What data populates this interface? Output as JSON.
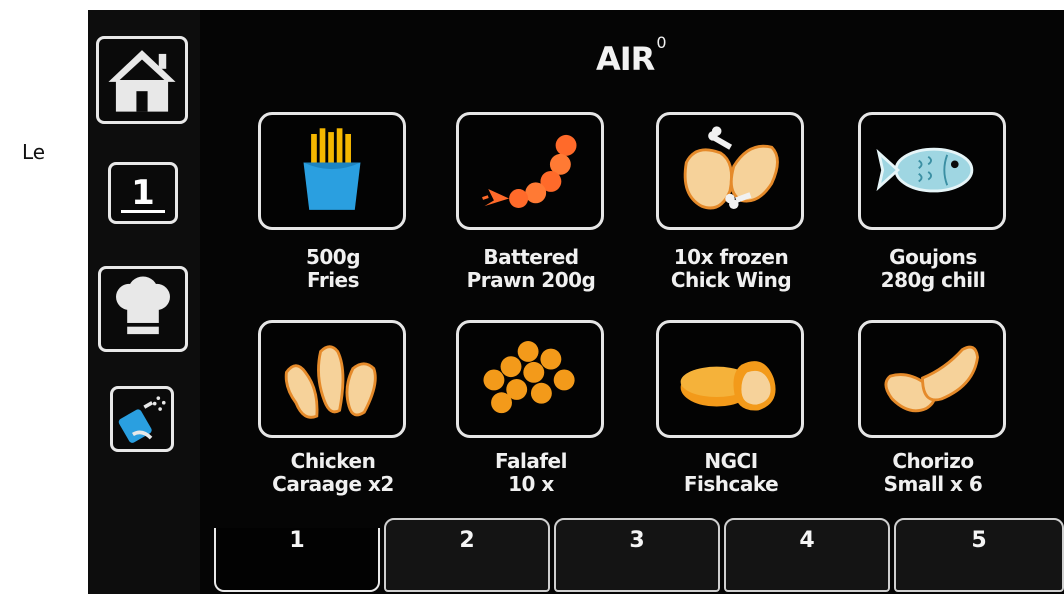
{
  "side_text": "Le",
  "header": {
    "logo": "AIR",
    "logo_superscript": "0"
  },
  "sidebar": {
    "items": [
      {
        "name": "home",
        "icon": "house-icon"
      },
      {
        "name": "page",
        "icon": "page-number-icon",
        "label": "1"
      },
      {
        "name": "chef",
        "icon": "chef-hat-icon"
      },
      {
        "name": "clean",
        "icon": "cleaning-spray-icon"
      }
    ]
  },
  "presets": [
    {
      "line1": "500g",
      "line2": "Fries",
      "icon": "fries-icon"
    },
    {
      "line1": "Battered",
      "line2": "Prawn 200g",
      "icon": "prawn-icon"
    },
    {
      "line1": "10x frozen",
      "line2": "Chick Wing",
      "icon": "chicken-wing-icon"
    },
    {
      "line1": "Goujons",
      "line2": "280g chill",
      "icon": "fish-icon"
    },
    {
      "line1": "Chicken",
      "line2": "Caraage x2",
      "icon": "chicken-karaage-icon"
    },
    {
      "line1": "Falafel",
      "line2": "10 x",
      "icon": "falafel-icon"
    },
    {
      "line1": "NGCI",
      "line2": "Fishcake",
      "icon": "fishcake-icon"
    },
    {
      "line1": "Chorizo",
      "line2": "Small x 6",
      "icon": "chorizo-icon"
    }
  ],
  "tabs": [
    {
      "label": "1",
      "active": true
    },
    {
      "label": "2",
      "active": false
    },
    {
      "label": "3",
      "active": false
    },
    {
      "label": "4",
      "active": false
    },
    {
      "label": "5",
      "active": false
    }
  ],
  "colors": {
    "background": "#050505",
    "border": "#e6e6e6",
    "fries": "#f5b700",
    "fries_box": "#2a9fe0",
    "prawn": "#ff6a2a",
    "food_light": "#f6d29a",
    "food_outline": "#e58a2a",
    "fish": "#9fd6e2",
    "falafel": "#f39a1a"
  }
}
